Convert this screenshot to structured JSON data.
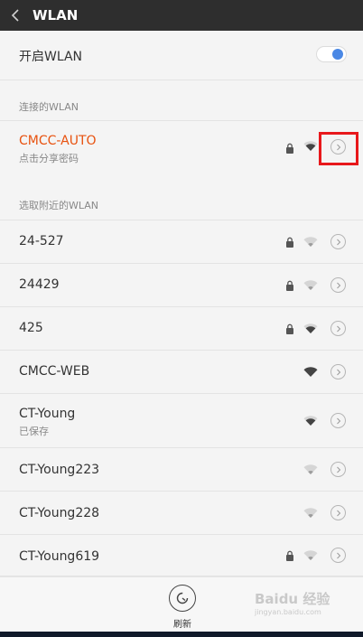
{
  "header": {
    "title": "WLAN"
  },
  "toggle_row": {
    "label": "开启WLAN",
    "state": "on"
  },
  "sections": {
    "connected": "连接的WLAN",
    "nearby": "选取附近的WLAN"
  },
  "connected": {
    "ssid": "CMCC-AUTO",
    "sub": "点击分享密码",
    "locked": true,
    "color": "#e8520f"
  },
  "networks": [
    {
      "ssid": "24-527",
      "sub": "",
      "locked": true,
      "signal": "weak"
    },
    {
      "ssid": "24429",
      "sub": "",
      "locked": true,
      "signal": "weak"
    },
    {
      "ssid": "425",
      "sub": "",
      "locked": true,
      "signal": "medium"
    },
    {
      "ssid": "CMCC-WEB",
      "sub": "",
      "locked": false,
      "signal": "strong"
    },
    {
      "ssid": "CT-Young",
      "sub": "已保存",
      "locked": false,
      "signal": "medium"
    },
    {
      "ssid": "CT-Young223",
      "sub": "",
      "locked": false,
      "signal": "weak"
    },
    {
      "ssid": "CT-Young228",
      "sub": "",
      "locked": false,
      "signal": "weak"
    },
    {
      "ssid": "CT-Young619",
      "sub": "",
      "locked": true,
      "signal": "weak"
    }
  ],
  "bottom": {
    "refresh_label": "刷新"
  },
  "watermark": {
    "text": "Baidu 经验",
    "sub": "jingyan.baidu.com"
  },
  "icons": {
    "back": "chevron-left-icon",
    "lock": "lock-icon",
    "wifi": "wifi-icon",
    "detail": "chevron-right-circle-icon",
    "refresh": "refresh-icon"
  }
}
